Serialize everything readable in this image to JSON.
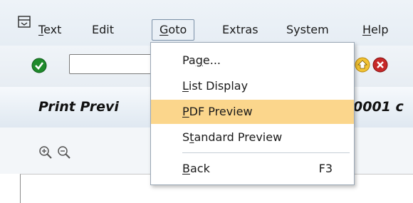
{
  "menubar": {
    "items": [
      {
        "label": "Text",
        "ul": "T",
        "rest": "ext"
      },
      {
        "label": "Edit",
        "ul": "",
        "rest": "Edit"
      },
      {
        "label": "Goto",
        "ul": "G",
        "rest": "oto"
      },
      {
        "label": "Extras",
        "ul": "",
        "rest": "Extras"
      },
      {
        "label": "System",
        "ul": "",
        "rest": "System"
      },
      {
        "label": "Help",
        "ul": "H",
        "rest": "elp"
      }
    ]
  },
  "toolbar": {
    "command_field_value": "",
    "icons": [
      "enter-check-icon",
      "exit-icon",
      "cancel-icon"
    ]
  },
  "title": {
    "left": "Print Previ",
    "right": "0001 c"
  },
  "app_toolbar": {
    "icons": [
      "zoom-in-icon",
      "zoom-out-icon"
    ]
  },
  "dropdown": {
    "items": [
      {
        "pre": "Pa",
        "ul": "g",
        "post": "e...",
        "shortcut": ""
      },
      {
        "pre": "",
        "ul": "L",
        "post": "ist Display",
        "shortcut": ""
      },
      {
        "pre": "",
        "ul": "P",
        "post": "DF Preview",
        "shortcut": "",
        "highlighted": true
      },
      {
        "pre": "S",
        "ul": "t",
        "post": "andard Preview",
        "shortcut": ""
      },
      {
        "pre": "",
        "ul": "B",
        "post": "ack",
        "shortcut": "F3"
      }
    ]
  },
  "colors": {
    "highlight": "#fbd68c",
    "menubar_bg": "#eaf0f6"
  }
}
